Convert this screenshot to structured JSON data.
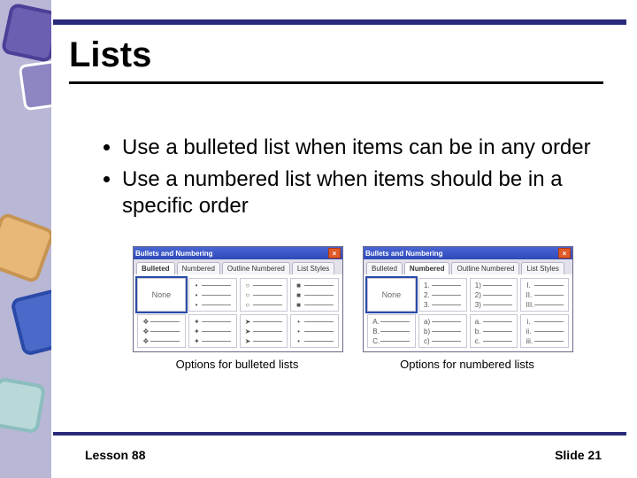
{
  "title": "Lists",
  "bullet_items": [
    "Use a bulleted list when items can be in any order",
    "Use a numbered list when items should be in a specific order"
  ],
  "dialog": {
    "window_title": "Bullets and Numbering",
    "close_glyph": "×",
    "none_label": "None",
    "bulleted": {
      "tabs": [
        "Bulleted",
        "Numbered",
        "Outline Numbered",
        "List Styles"
      ],
      "active_tab": 0,
      "caption": "Options for bulleted lists",
      "markers": [
        [
          "",
          "",
          ""
        ],
        [
          "•",
          "•",
          "•"
        ],
        [
          "○",
          "○",
          "○"
        ],
        [
          "■",
          "■",
          "■"
        ],
        [
          "❖",
          "❖",
          "❖"
        ],
        [
          "✦",
          "✦",
          "✦"
        ],
        [
          "➤",
          "➤",
          "➤"
        ],
        [
          "•",
          "•",
          "•"
        ]
      ]
    },
    "numbered": {
      "tabs": [
        "Bulleted",
        "Numbered",
        "Outline Numbered",
        "List Styles"
      ],
      "active_tab": 1,
      "caption": "Options for numbered lists",
      "markers": [
        [
          "",
          "",
          ""
        ],
        [
          "1.",
          "2.",
          "3."
        ],
        [
          "1)",
          "2)",
          "3)"
        ],
        [
          "I.",
          "II.",
          "III."
        ],
        [
          "A.",
          "B.",
          "C."
        ],
        [
          "a)",
          "b)",
          "c)"
        ],
        [
          "a.",
          "b.",
          "c."
        ],
        [
          "i.",
          "ii.",
          "iii."
        ]
      ]
    }
  },
  "footer": {
    "left": "Lesson 88",
    "right": "Slide 21"
  }
}
